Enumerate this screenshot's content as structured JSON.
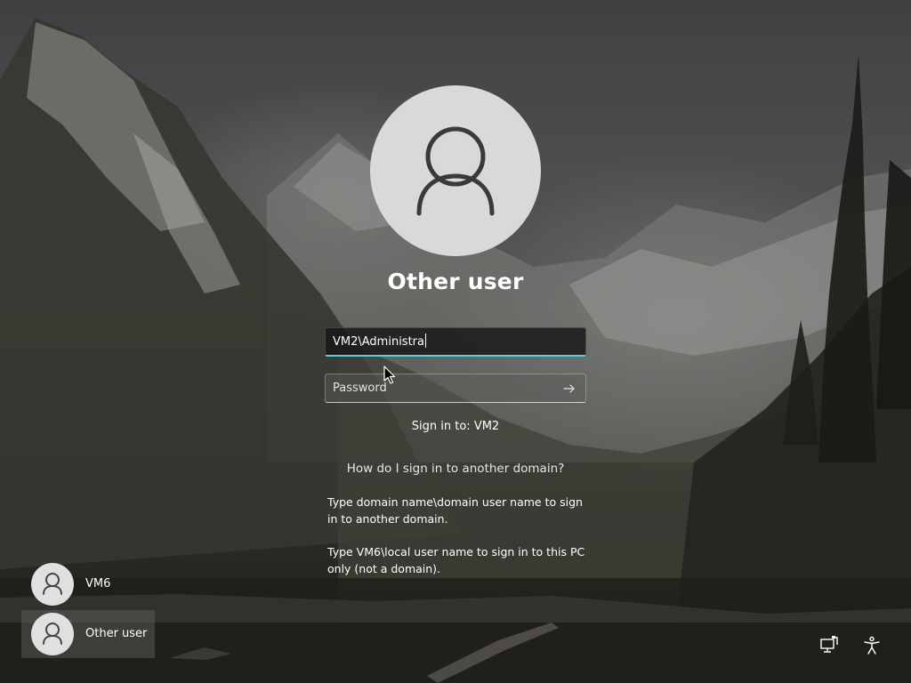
{
  "login": {
    "user_name": "Other user",
    "username_value": "VM2\\Administra",
    "password_placeholder": "Password",
    "sign_in_to": "Sign in to: VM2",
    "help_link": "How do I sign in to another domain?",
    "help_text_1": "Type domain name\\domain user name to sign in to another domain.",
    "help_text_2": "Type VM6\\local user name to sign in to this PC only (not a domain)."
  },
  "user_list": [
    {
      "label": "VM6",
      "selected": false
    },
    {
      "label": "Other user",
      "selected": true
    }
  ],
  "icons": {
    "avatar": "user-silhouette-icon",
    "submit": "arrow-right-icon",
    "network": "network-icon",
    "accessibility": "accessibility-icon",
    "cursor": "mouse-pointer"
  },
  "colors": {
    "focus_underline": "#60cdd8",
    "avatar_bg": "#d9d9d9",
    "text": "#ffffff"
  }
}
